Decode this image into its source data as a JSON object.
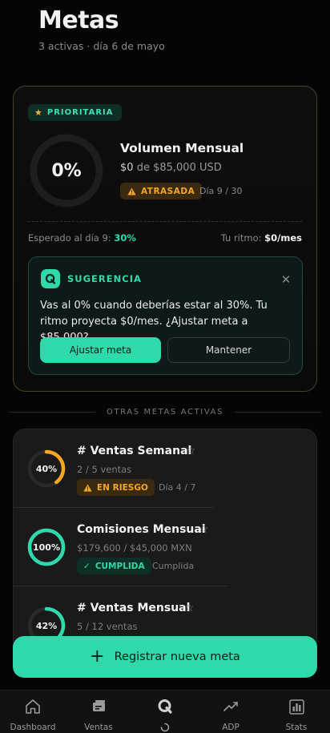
{
  "header": {
    "title": "Metas",
    "subtitle": "3 activas · día 6 de mayo"
  },
  "priority": {
    "badge": "PRIORITARIA",
    "percent_label": "0%",
    "progress": 0,
    "name": "Volumen Mensual",
    "current": "$0",
    "target_prefix": "de",
    "target": "$85,000 USD",
    "status": "ATRASADA",
    "day": "Día 9 / 30",
    "expected_label": "Esperado al día 9:",
    "expected_value": "30%",
    "pace_label": "Tu ritmo:",
    "pace_value": "$0/mes"
  },
  "suggestion": {
    "title": "SUGERENCIA",
    "text": "Vas al 0% cuando deberías estar al 30%. Tu ritmo proyecta $0/mes. ¿Ajustar meta a $85,000?",
    "primary_label": "Ajustar meta",
    "secondary_label": "Mantener"
  },
  "section_label": "OTRAS METAS ACTIVAS",
  "goals": [
    {
      "name": "# Ventas Semanal",
      "detail": "2 / 5 ventas",
      "percent_label": "40%",
      "progress": 0.4,
      "status": "EN RIESGO",
      "status_kind": "risk",
      "meta": "Día 4 / 7",
      "color": "#f5a623"
    },
    {
      "name": "Comisiones Mensual",
      "detail": "$179,600 / $45,000 MXN",
      "percent_label": "100%",
      "progress": 1,
      "status": "CUMPLIDA",
      "status_kind": "done",
      "meta": "Cumplida",
      "color": "#2fd9a9"
    },
    {
      "name": "# Ventas Mensual",
      "detail": "5 / 12 ventas",
      "percent_label": "42%",
      "progress": 0.42,
      "color": "#2fd9a9"
    }
  ],
  "cta_label": "Registrar nueva meta",
  "nav": [
    {
      "label": "Dashboard",
      "icon": "home-icon"
    },
    {
      "label": "Ventas",
      "icon": "sales-icon"
    },
    {
      "label": "",
      "icon": "q-logo-icon"
    },
    {
      "label": "ADP",
      "icon": "trend-icon"
    },
    {
      "label": "Stats",
      "icon": "bar-chart-icon"
    }
  ],
  "colors": {
    "accent": "#2fd9a9",
    "warning": "#f5a623",
    "star": "#f5b731"
  }
}
